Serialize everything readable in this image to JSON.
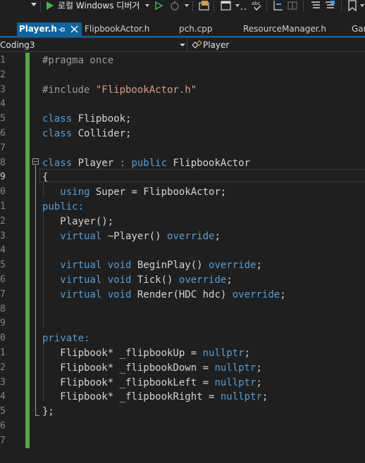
{
  "toolbar": {
    "run_label": "로컬 Windows 디버거",
    "icons": [
      "dropdown-arrow",
      "start-debug-icon",
      "start-without-debug-icon",
      "hot-reload-icon",
      "solution-explorer-icon",
      "tool-icon",
      "spellcheck-icon",
      "step-icon",
      "comment-icon",
      "bookmark-icon"
    ]
  },
  "tabs": [
    {
      "label": "Player.h",
      "active": true
    },
    {
      "label": "FlipbookActor.h",
      "active": false
    },
    {
      "label": "pch.cpp",
      "active": false
    },
    {
      "label": "ResourceManager.h",
      "active": false
    },
    {
      "label": "Gar",
      "active": false
    }
  ],
  "nav": {
    "project": "Coding3",
    "scope": "Player"
  },
  "editor": {
    "accent_green": "#57a64a",
    "line_numbers": [
      "1",
      "2",
      "3",
      "4",
      "5",
      "6",
      "7",
      "8",
      "9",
      "0",
      "1",
      "2",
      "3",
      "4",
      "5",
      "6",
      "7",
      "8",
      "9",
      "0",
      "1",
      "2",
      "3",
      "4",
      "5",
      "6",
      "7"
    ],
    "lines": [
      [
        {
          "c": "pp",
          "t": "#pragma once"
        }
      ],
      [],
      [
        {
          "c": "pp",
          "t": "#include "
        },
        {
          "c": "str",
          "t": "\"FlipbookActor.h\""
        }
      ],
      [],
      [
        {
          "c": "kw",
          "t": "class"
        },
        {
          "c": "pl",
          "t": " Flipbook;"
        }
      ],
      [
        {
          "c": "kw",
          "t": "class"
        },
        {
          "c": "pl",
          "t": " Collider;"
        }
      ],
      [],
      [
        {
          "c": "kw",
          "t": "class"
        },
        {
          "c": "pl",
          "t": " Player "
        },
        {
          "c": "kw",
          "t": ": public"
        },
        {
          "c": "pl",
          "t": " FlipbookActor"
        }
      ],
      [
        {
          "c": "pl",
          "t": "{"
        }
      ],
      [
        {
          "c": "pl",
          "t": "   "
        },
        {
          "c": "kw",
          "t": "using"
        },
        {
          "c": "pl",
          "t": " Super = FlipbookActor;"
        }
      ],
      [
        {
          "c": "kw",
          "t": "public:"
        }
      ],
      [
        {
          "c": "pl",
          "t": "   Player();"
        }
      ],
      [
        {
          "c": "pl",
          "t": "   "
        },
        {
          "c": "kw",
          "t": "virtual"
        },
        {
          "c": "pl",
          "t": " ~Player() "
        },
        {
          "c": "kw",
          "t": "override"
        },
        {
          "c": "pl",
          "t": ";"
        }
      ],
      [],
      [
        {
          "c": "pl",
          "t": "   "
        },
        {
          "c": "kw",
          "t": "virtual void"
        },
        {
          "c": "pl",
          "t": " BeginPlay() "
        },
        {
          "c": "kw",
          "t": "override"
        },
        {
          "c": "pl",
          "t": ";"
        }
      ],
      [
        {
          "c": "pl",
          "t": "   "
        },
        {
          "c": "kw",
          "t": "virtual void"
        },
        {
          "c": "pl",
          "t": " Tick() "
        },
        {
          "c": "kw",
          "t": "override"
        },
        {
          "c": "pl",
          "t": ";"
        }
      ],
      [
        {
          "c": "pl",
          "t": "   "
        },
        {
          "c": "kw",
          "t": "virtual void"
        },
        {
          "c": "pl",
          "t": " Render(HDC hdc) "
        },
        {
          "c": "kw",
          "t": "override"
        },
        {
          "c": "pl",
          "t": ";"
        }
      ],
      [],
      [],
      [
        {
          "c": "kw",
          "t": "private:"
        }
      ],
      [
        {
          "c": "pl",
          "t": "   Flipbook* _flipbookUp = "
        },
        {
          "c": "kw",
          "t": "nullptr"
        },
        {
          "c": "pl",
          "t": ";"
        }
      ],
      [
        {
          "c": "pl",
          "t": "   Flipbook* _flipbookDown = "
        },
        {
          "c": "kw",
          "t": "nullptr"
        },
        {
          "c": "pl",
          "t": ";"
        }
      ],
      [
        {
          "c": "pl",
          "t": "   Flipbook* _flipbookLeft = "
        },
        {
          "c": "kw",
          "t": "nullptr"
        },
        {
          "c": "pl",
          "t": ";"
        }
      ],
      [
        {
          "c": "pl",
          "t": "   Flipbook* _flipbookRight = "
        },
        {
          "c": "kw",
          "t": "nullptr"
        },
        {
          "c": "pl",
          "t": ";"
        }
      ],
      [
        {
          "c": "pl",
          "t": "};"
        }
      ],
      [],
      []
    ]
  }
}
